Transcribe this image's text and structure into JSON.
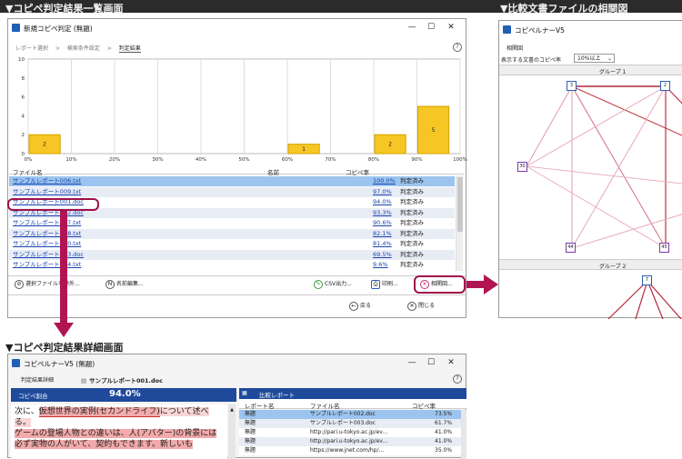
{
  "section_titles": {
    "list": "▼コピペ判定結果一覧画面",
    "correlation": "▼比較文書ファイルの相関図",
    "detail": "▼コピペ判定結果詳細画面"
  },
  "main_window": {
    "title": "新規コピペ判定 (無題)",
    "breadcrumb": [
      "レポート選択",
      ">",
      "検索条件設定",
      ">",
      "判定結果"
    ],
    "help": "?"
  },
  "chart_data": {
    "type": "bar",
    "x_ticks": [
      "0%",
      "10%",
      "20%",
      "30%",
      "40%",
      "50%",
      "60%",
      "70%",
      "80%",
      "90%",
      "100%"
    ],
    "y_ticks": [
      "10",
      "8",
      "6",
      "4",
      "2",
      "0"
    ],
    "ylim": [
      0,
      10
    ],
    "bars": [
      {
        "bin_start": 0,
        "count": 2
      },
      {
        "bin_start": 60,
        "count": 1
      },
      {
        "bin_start": 80,
        "count": 2
      },
      {
        "bin_start": 90,
        "count": 5
      }
    ]
  },
  "table": {
    "headers": [
      "ファイル名",
      "名前",
      "コピペ率"
    ],
    "rows": [
      {
        "file": "サンプルレポート006.txt",
        "rate": "100.0%",
        "status": "判定済み",
        "selected": true
      },
      {
        "file": "サンプルレポート009.txt",
        "rate": "97.0%",
        "status": "判定済み"
      },
      {
        "file": "サンプルレポート001.doc",
        "rate": "94.0%",
        "status": "判定済み"
      },
      {
        "file": "サンプルレポート002.doc",
        "rate": "93.3%",
        "status": "判定済み"
      },
      {
        "file": "サンプルレポート007.txt",
        "rate": "90.6%",
        "status": "判定済み"
      },
      {
        "file": "サンプルレポート008.txt",
        "rate": "82.1%",
        "status": "判定済み"
      },
      {
        "file": "サンプルレポート010.txt",
        "rate": "81.4%",
        "status": "判定済み"
      },
      {
        "file": "サンプルレポート003.doc",
        "rate": "69.5%",
        "status": "判定済み"
      },
      {
        "file": "サンプルレポート004.txt",
        "rate": "9.6%",
        "status": "判定済み"
      }
    ]
  },
  "buttons": {
    "exclude": "選択ファイルを除外...",
    "rename": "名前編集...",
    "csv": "CSV出力...",
    "print": "印刷...",
    "correlation": "相関図...",
    "back": "戻る",
    "close": "閉じる"
  },
  "corr_window": {
    "title": "コピペルナーV5",
    "menu": "相関図",
    "filter_label": "表示する文書のコピペ率",
    "filter_value": "10%以上",
    "group1": "グループ 1",
    "group2": "グループ 2",
    "nodes": [
      "3",
      "2",
      "30",
      "44",
      "45",
      "7"
    ]
  },
  "detail_window": {
    "title": "コピペルナーV5 (無題)",
    "tab_label": "判定結果詳細",
    "file": "サンプルレポート001.doc",
    "rate_label": "コピペ割合",
    "rate_value": "94.0%",
    "text_1": "次に、",
    "text_2": "仮想世界の実例(セカンドライフ)",
    "text_3": "について述べる。",
    "text_4": "ゲームの登場人物との違いは、人(アバター)の背景には必ず実物の人がいて、契約もできます。新しいも",
    "compare_header": "比較レポート",
    "compare_columns": [
      "レポート名",
      "ファイル名",
      "コピペ率"
    ],
    "compare_rows": [
      {
        "name": "無題",
        "file": "サンプルレポート002.doc",
        "rate": "73.5%",
        "selected": true
      },
      {
        "name": "無題",
        "file": "サンプルレポート003.doc",
        "rate": "61.7%"
      },
      {
        "name": "無題",
        "file": "http://pari.u-tokyo.ac.jp/ev...",
        "rate": "41.0%"
      },
      {
        "name": "無題",
        "file": "http://pari.u-tokyo.ac.jp/ev...",
        "rate": "41.0%"
      },
      {
        "name": "無題",
        "file": "https://www.jnet.com/hp/...",
        "rate": "35.0%"
      }
    ]
  }
}
